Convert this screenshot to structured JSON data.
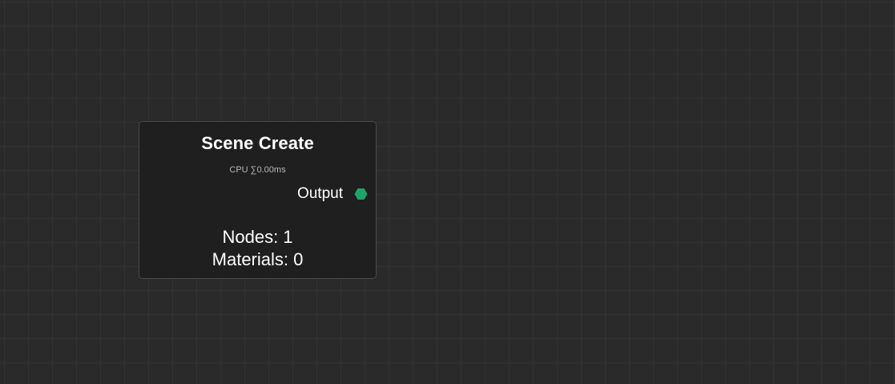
{
  "node": {
    "title": "Scene Create",
    "cpu_label": "CPU ∑0.00ms",
    "output": {
      "label": "Output",
      "pin_color": "#1fa36a"
    },
    "info": [
      {
        "text": "Nodes: 1"
      },
      {
        "text": "Materials: 0"
      }
    ]
  }
}
